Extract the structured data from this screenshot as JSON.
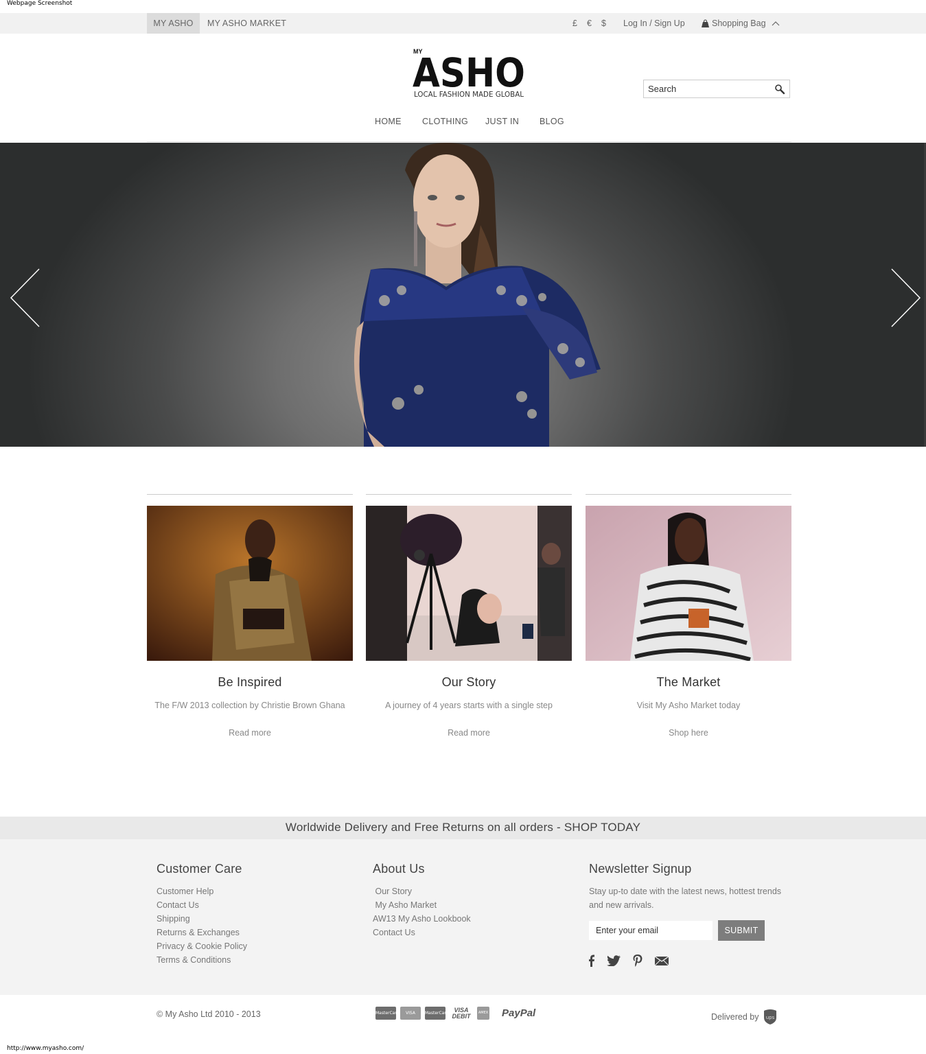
{
  "window": {
    "caption": "Webpage Screenshot",
    "status_url": "http://www.myasho.com/"
  },
  "topbar": {
    "tabs": [
      {
        "label": "MY ASHO"
      },
      {
        "label": "MY ASHO MARKET"
      }
    ],
    "currencies": [
      "£",
      "€",
      "$"
    ],
    "login_label": "Log In / Sign Up",
    "bag_label": "Shopping Bag"
  },
  "header": {
    "logo_small": "MY",
    "logo_text": "ASHO",
    "logo_tagline": "LOCAL FASHION MADE GLOBAL",
    "search_placeholder": "Search"
  },
  "nav": [
    "HOME",
    "CLOTHING",
    "JUST IN",
    "BLOG"
  ],
  "hero": {
    "slider_prev": "previous-slide",
    "slider_next": "next-slide"
  },
  "features": [
    {
      "title": "Be Inspired",
      "subtitle": "The F/W 2013 collection by Christie Brown Ghana",
      "link": "Read more"
    },
    {
      "title": "Our Story",
      "subtitle": "A journey of 4 years starts with a single step",
      "link": "Read more"
    },
    {
      "title": "The Market",
      "subtitle": "Visit My Asho Market today",
      "link": "Shop here"
    }
  ],
  "promo": "Worldwide Delivery and Free Returns on all orders - SHOP TODAY",
  "footer": {
    "customer_care": {
      "title": "Customer Care",
      "links": [
        "Customer Help",
        "Contact Us",
        "Shipping",
        "Returns & Exchanges",
        "Privacy & Cookie Policy",
        "Terms & Conditions"
      ]
    },
    "about": {
      "title": "About Us",
      "links": [
        " Our Story",
        " My Asho Market",
        "AW13 My Asho Lookbook",
        "Contact Us"
      ]
    },
    "newsletter": {
      "title": "Newsletter Signup",
      "text": "Stay up-to date with the latest news, hottest trends and new arrivals.",
      "placeholder": "Enter your email",
      "submit": "SUBMIT",
      "social": [
        "facebook-icon",
        "twitter-icon",
        "pinterest-icon",
        "email-icon"
      ]
    }
  },
  "bottom": {
    "copyright": "© My Asho Ltd 2010 - 2013",
    "payments": [
      "MasterCard",
      "VISA",
      "MasterCard",
      "VISA DEBIT",
      "AMEX",
      "PayPal"
    ],
    "delivered_by": "Delivered by",
    "carrier": "ups"
  },
  "colors": {
    "topbar_bg": "#f1f1f1",
    "promo_bg": "#e9e9e9",
    "footer_bg": "#f3f3f3",
    "submit_bg": "#7d7d7d"
  }
}
